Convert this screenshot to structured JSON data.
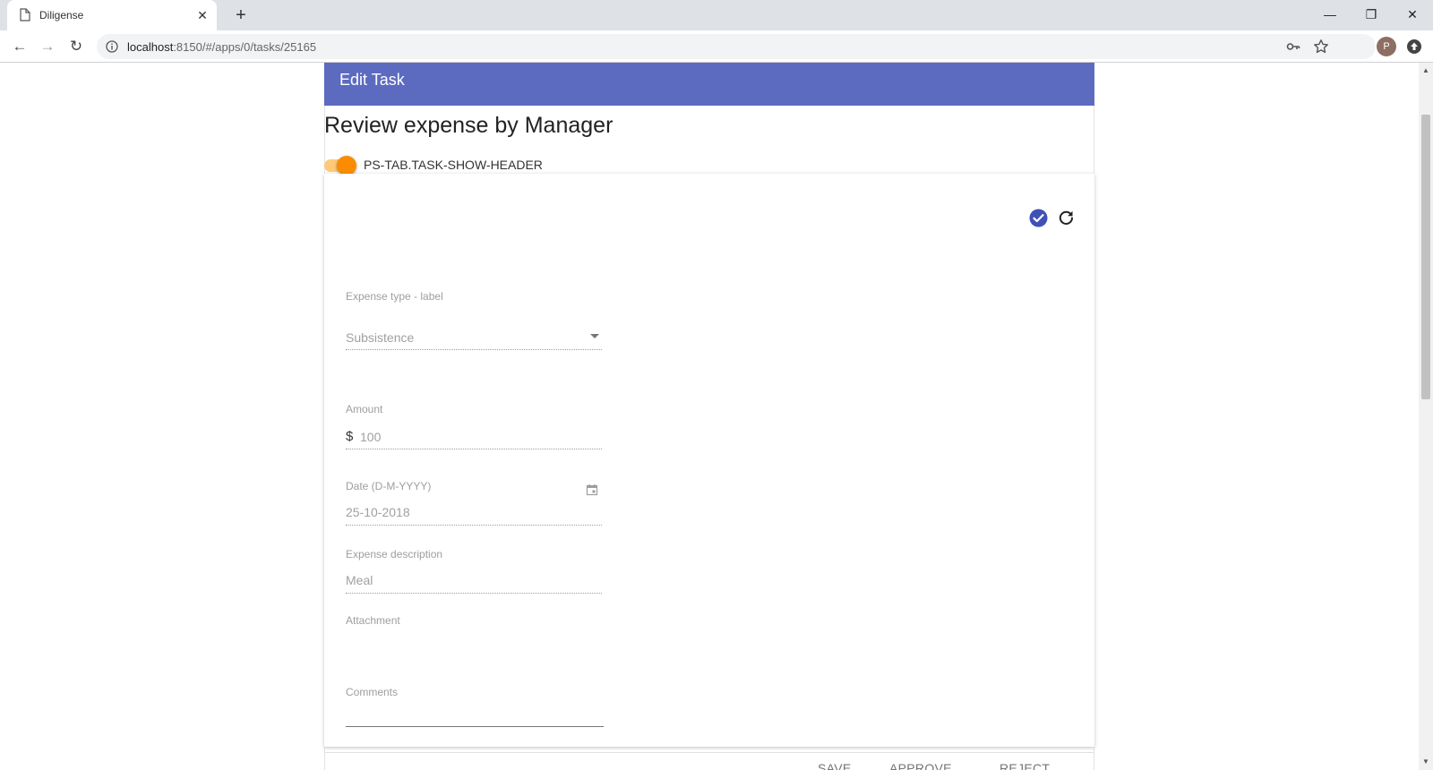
{
  "browser": {
    "tab_title": "Diligense",
    "new_tab_symbol": "+",
    "close_symbol": "✕",
    "url_host": "localhost",
    "url_rest": ":8150/#/apps/0/tasks/25165",
    "profile_initial": "P",
    "window_controls": {
      "minimize": "—",
      "maximize": "❐",
      "close": "✕"
    },
    "nav": {
      "back": "←",
      "forward": "→",
      "reload": "↻"
    }
  },
  "header": {
    "title": "Edit Task"
  },
  "task": {
    "name": "Review expense by Manager",
    "toggle_label": "PS-TAB.TASK-SHOW-HEADER",
    "toggle_on": true
  },
  "form": {
    "expense_type": {
      "label": "Expense type - label",
      "value": "Subsistence"
    },
    "amount": {
      "label": "Amount",
      "currency": "$",
      "value": "100"
    },
    "date": {
      "label": "Date (D-M-YYYY)",
      "value": "25-10-2018"
    },
    "description": {
      "label": "Expense description",
      "value": "Meal"
    },
    "attachment": {
      "label": "Attachment"
    },
    "comments": {
      "label": "Comments",
      "value": ""
    }
  },
  "actions": {
    "save": "SAVE",
    "approve": "APPROVE",
    "reject": "REJECT"
  },
  "colors": {
    "header_bg": "#5c6bc0",
    "toggle_accent": "#fb8c00",
    "check_icon": "#3f51b5"
  }
}
